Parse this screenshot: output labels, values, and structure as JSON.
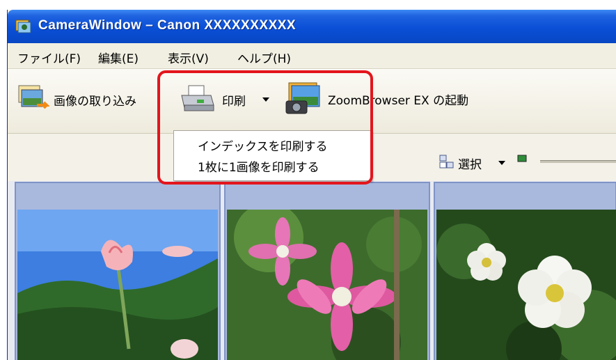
{
  "window": {
    "title": "CameraWindow – Canon XXXXXXXXXX"
  },
  "menu": {
    "items": [
      {
        "label": "ファイル(F)"
      },
      {
        "label": "編集(E)"
      },
      {
        "label": "表示(V)"
      },
      {
        "label": "ヘルプ(H)"
      }
    ]
  },
  "toolbar": {
    "import_label": "画像の取り込み",
    "print_label": "印刷",
    "zoombrowser_label": "ZoomBrowser EX の起動"
  },
  "print_menu": {
    "items": [
      {
        "label": "インデックスを印刷する"
      },
      {
        "label": "1枚に1画像を印刷する"
      }
    ]
  },
  "selection": {
    "label": "選択"
  },
  "thumbnails": [
    {
      "subject": "pink lily against blue sky and hills"
    },
    {
      "subject": "pink clematis flowers"
    },
    {
      "subject": "white wild rose"
    }
  ],
  "colors": {
    "titlebar": "#0a4fd6",
    "highlight": "#e3151d",
    "thumb_frame": "#a9b9de"
  }
}
